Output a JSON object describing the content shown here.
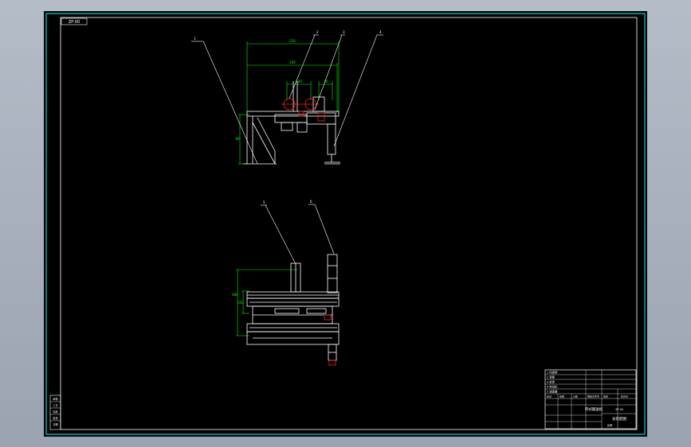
{
  "colors": {
    "frame": "#00ffff",
    "dimension": "#00ff00",
    "geometry": "#ffffff",
    "highlight": "#ff2020",
    "sheet": "#000000",
    "background": "#a8b0bc"
  },
  "title_block": {
    "project_title": "带式输送机",
    "drawing_name": "总装配图",
    "drawing_no": "ZP-00",
    "scale_label": "比例",
    "header_cells": [
      "标记",
      "处数",
      "分区",
      "更改文件号",
      "签名",
      "年月日"
    ]
  },
  "corner_stamp": "ZP-00",
  "side_table": {
    "rows": [
      "审核",
      "工艺",
      "标准",
      "批准",
      "日期"
    ]
  },
  "parts_list": {
    "rows": [
      "1 托辊架",
      "2 滚筒",
      "3 机架",
      "4 电动机",
      "5 减速器"
    ]
  },
  "view_labels": {
    "front_dims": [
      "250",
      "200",
      "100",
      "50",
      "80"
    ],
    "top_dims": [
      "480",
      "350"
    ],
    "leaders_front": [
      "1",
      "2",
      "3",
      "4"
    ],
    "leaders_top": [
      "5",
      "6"
    ]
  }
}
